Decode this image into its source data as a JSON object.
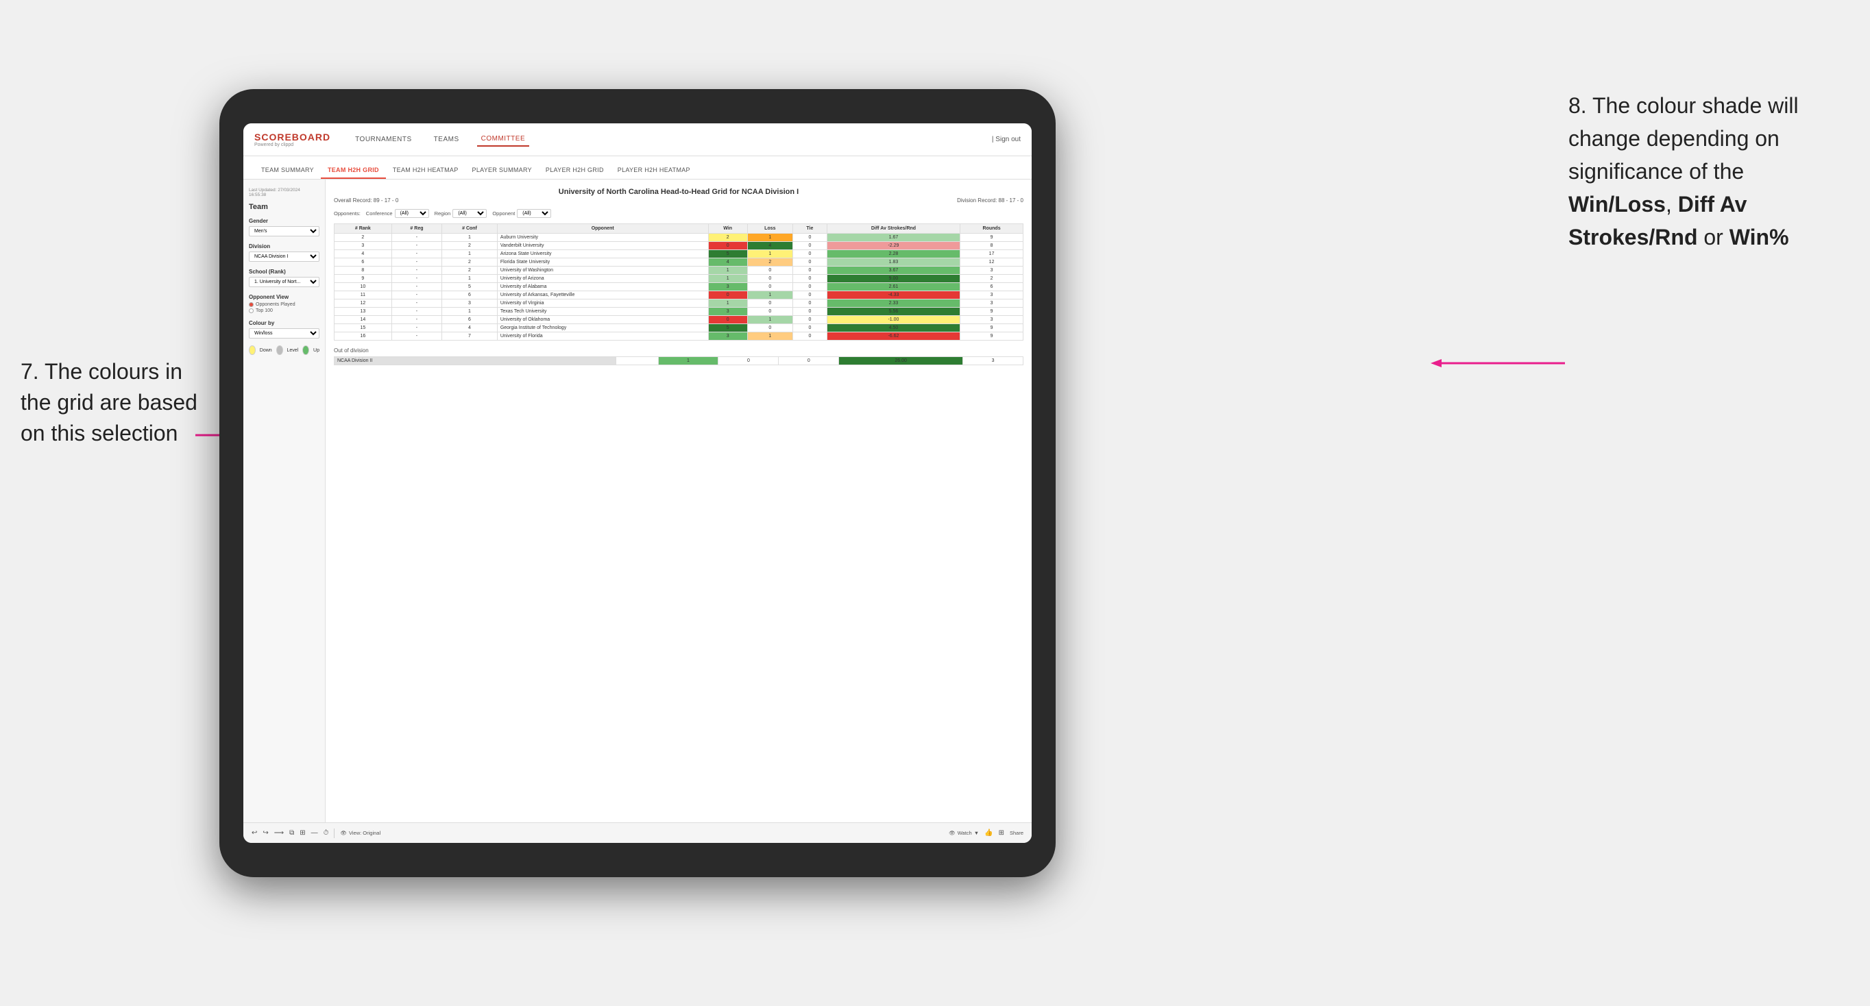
{
  "annotations": {
    "left_title": "7. The colours in the grid are based on this selection",
    "right_title": "8. The colour shade will change depending on significance of the",
    "right_bold1": "Win/Loss",
    "right_separator1": ", ",
    "right_bold2": "Diff Av Strokes/Rnd",
    "right_separator2": " or ",
    "right_bold3": "Win%"
  },
  "nav": {
    "logo": "SCOREBOARD",
    "logo_sub": "Powered by clippd",
    "links": [
      "TOURNAMENTS",
      "TEAMS",
      "COMMITTEE"
    ],
    "active_link": "COMMITTEE",
    "sign_out": "Sign out"
  },
  "sub_nav": {
    "items": [
      "TEAM SUMMARY",
      "TEAM H2H GRID",
      "TEAM H2H HEATMAP",
      "PLAYER SUMMARY",
      "PLAYER H2H GRID",
      "PLAYER H2H HEATMAP"
    ],
    "active": "TEAM H2H GRID"
  },
  "sidebar": {
    "timestamp_label": "Last Updated: 27/03/2024",
    "timestamp_time": "16:55:38",
    "team_label": "Team",
    "gender_label": "Gender",
    "gender_value": "Men's",
    "division_label": "Division",
    "division_value": "NCAA Division I",
    "school_label": "School (Rank)",
    "school_value": "1. University of Nort...",
    "opponent_view_label": "Opponent View",
    "radio1": "Opponents Played",
    "radio2": "Top 100",
    "colour_by_label": "Colour by",
    "colour_by_value": "Win/loss",
    "legend": {
      "down_label": "Down",
      "level_label": "Level",
      "up_label": "Up"
    }
  },
  "grid": {
    "title": "University of North Carolina Head-to-Head Grid for NCAA Division I",
    "overall_record": "Overall Record: 89 - 17 - 0",
    "division_record": "Division Record: 88 - 17 - 0",
    "filters": {
      "conference_label": "Conference",
      "conference_value": "(All)",
      "region_label": "Region",
      "region_value": "(All)",
      "opponent_label": "Opponent",
      "opponent_value": "(All)",
      "opponents_label": "Opponents:"
    },
    "columns": [
      "# Rank",
      "# Reg",
      "# Conf",
      "Opponent",
      "Win",
      "Loss",
      "Tie",
      "Diff Av Strokes/Rnd",
      "Rounds"
    ],
    "rows": [
      {
        "rank": "2",
        "reg": "-",
        "conf": "1",
        "opponent": "Auburn University",
        "win": "2",
        "loss": "1",
        "tie": "0",
        "diff": "1.67",
        "rounds": "9",
        "win_color": "yellow",
        "loss_color": "orange",
        "tie_color": "white",
        "diff_color": "green_light",
        "rounds_color": "white"
      },
      {
        "rank": "3",
        "reg": "-",
        "conf": "2",
        "opponent": "Vanderbilt University",
        "win": "0",
        "loss": "4",
        "tie": "0",
        "diff": "-2.29",
        "rounds": "8",
        "win_color": "red",
        "loss_color": "green_dark",
        "tie_color": "white",
        "diff_color": "red_light",
        "rounds_color": "white"
      },
      {
        "rank": "4",
        "reg": "-",
        "conf": "1",
        "opponent": "Arizona State University",
        "win": "5",
        "loss": "1",
        "tie": "0",
        "diff": "2.28",
        "rounds": "17",
        "win_color": "green_dark",
        "loss_color": "yellow",
        "tie_color": "white",
        "diff_color": "green_med",
        "rounds_color": "white"
      },
      {
        "rank": "6",
        "reg": "-",
        "conf": "2",
        "opponent": "Florida State University",
        "win": "4",
        "loss": "2",
        "tie": "0",
        "diff": "1.83",
        "rounds": "12",
        "win_color": "green_med",
        "loss_color": "orange_light",
        "tie_color": "white",
        "diff_color": "green_light",
        "rounds_color": "white"
      },
      {
        "rank": "8",
        "reg": "-",
        "conf": "2",
        "opponent": "University of Washington",
        "win": "1",
        "loss": "0",
        "tie": "0",
        "diff": "3.67",
        "rounds": "3",
        "win_color": "green_light",
        "loss_color": "white",
        "tie_color": "white",
        "diff_color": "green_med",
        "rounds_color": "white"
      },
      {
        "rank": "9",
        "reg": "-",
        "conf": "1",
        "opponent": "University of Arizona",
        "win": "1",
        "loss": "0",
        "tie": "0",
        "diff": "9.00",
        "rounds": "2",
        "win_color": "green_light",
        "loss_color": "white",
        "tie_color": "white",
        "diff_color": "green_dark",
        "rounds_color": "white"
      },
      {
        "rank": "10",
        "reg": "-",
        "conf": "5",
        "opponent": "University of Alabama",
        "win": "3",
        "loss": "0",
        "tie": "0",
        "diff": "2.61",
        "rounds": "6",
        "win_color": "green_med",
        "loss_color": "white",
        "tie_color": "white",
        "diff_color": "green_med",
        "rounds_color": "white"
      },
      {
        "rank": "11",
        "reg": "-",
        "conf": "6",
        "opponent": "University of Arkansas, Fayetteville",
        "win": "0",
        "loss": "1",
        "tie": "0",
        "diff": "-4.33",
        "rounds": "3",
        "win_color": "red",
        "loss_color": "green_light",
        "tie_color": "white",
        "diff_color": "red",
        "rounds_color": "white"
      },
      {
        "rank": "12",
        "reg": "-",
        "conf": "3",
        "opponent": "University of Virginia",
        "win": "1",
        "loss": "0",
        "tie": "0",
        "diff": "2.33",
        "rounds": "3",
        "win_color": "green_light",
        "loss_color": "white",
        "tie_color": "white",
        "diff_color": "green_med",
        "rounds_color": "white"
      },
      {
        "rank": "13",
        "reg": "-",
        "conf": "1",
        "opponent": "Texas Tech University",
        "win": "3",
        "loss": "0",
        "tie": "0",
        "diff": "5.56",
        "rounds": "9",
        "win_color": "green_med",
        "loss_color": "white",
        "tie_color": "white",
        "diff_color": "green_dark",
        "rounds_color": "white"
      },
      {
        "rank": "14",
        "reg": "-",
        "conf": "6",
        "opponent": "University of Oklahoma",
        "win": "0",
        "loss": "1",
        "tie": "0",
        "diff": "-1.00",
        "rounds": "3",
        "win_color": "red",
        "loss_color": "green_light",
        "tie_color": "white",
        "diff_color": "yellow",
        "rounds_color": "white"
      },
      {
        "rank": "15",
        "reg": "-",
        "conf": "4",
        "opponent": "Georgia Institute of Technology",
        "win": "5",
        "loss": "0",
        "tie": "0",
        "diff": "4.50",
        "rounds": "9",
        "win_color": "green_dark",
        "loss_color": "white",
        "tie_color": "white",
        "diff_color": "green_dark",
        "rounds_color": "white"
      },
      {
        "rank": "16",
        "reg": "-",
        "conf": "7",
        "opponent": "University of Florida",
        "win": "3",
        "loss": "1",
        "tie": "0",
        "diff": "-6.62",
        "rounds": "9",
        "win_color": "green_med",
        "loss_color": "orange_light",
        "tie_color": "white",
        "diff_color": "red",
        "rounds_color": "white"
      }
    ],
    "out_of_division": {
      "label": "Out of division",
      "row": {
        "name": "NCAA Division II",
        "win": "1",
        "loss": "0",
        "tie": "0",
        "diff": "26.00",
        "rounds": "3"
      }
    }
  },
  "toolbar": {
    "view_label": "View: Original",
    "watch_label": "Watch",
    "share_label": "Share"
  }
}
